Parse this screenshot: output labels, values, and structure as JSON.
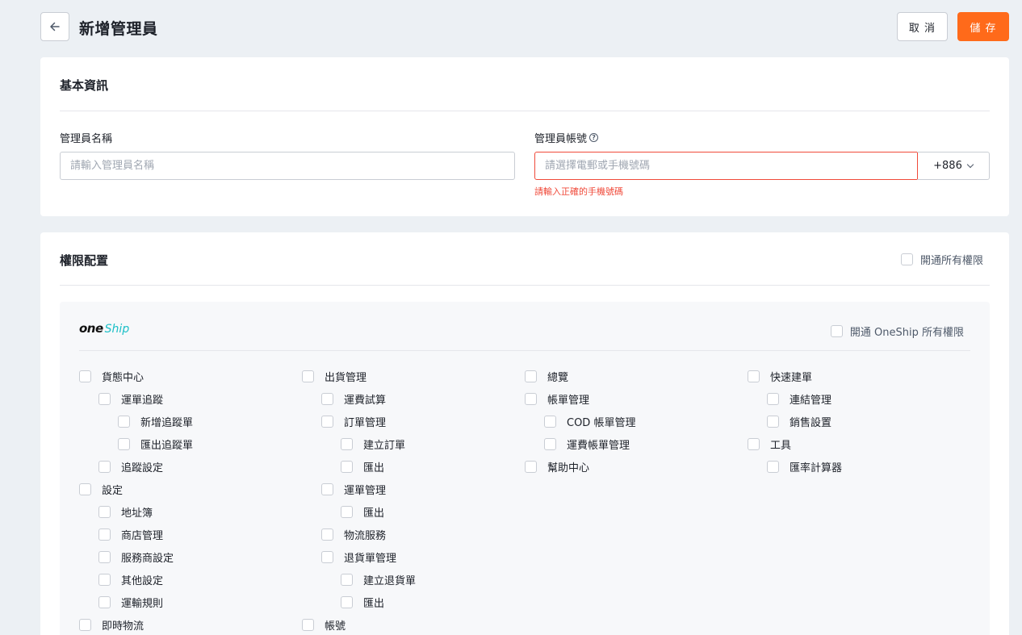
{
  "header": {
    "title": "新增管理員",
    "cancel_label": "取 消",
    "save_label": "儲 存"
  },
  "basic": {
    "section_title": "基本資訊",
    "name_label": "管理員名稱",
    "name_placeholder": "請輸入管理員名稱",
    "name_value": "",
    "account_label": "管理員帳號",
    "account_placeholder": "請選擇電郵或手機號碼",
    "account_value": "",
    "country_code": "+886",
    "error_message": "請輸入正確的手機號碼"
  },
  "permissions": {
    "section_title": "權限配置",
    "enable_all_label": "開通所有權限",
    "oneship": {
      "logo_one": "one",
      "logo_ship": "Ship",
      "enable_all_label": "開通 OneShip 所有權限",
      "columns": [
        [
          {
            "label": "貨態中心",
            "level": 0
          },
          {
            "label": "運單追蹤",
            "level": 1
          },
          {
            "label": "新增追蹤單",
            "level": 2
          },
          {
            "label": "匯出追蹤單",
            "level": 2
          },
          {
            "label": "追蹤設定",
            "level": 1
          },
          {
            "label": "設定",
            "level": 0
          },
          {
            "label": "地址簿",
            "level": 1
          },
          {
            "label": "商店管理",
            "level": 1
          },
          {
            "label": "服務商設定",
            "level": 1
          },
          {
            "label": "其他設定",
            "level": 1
          },
          {
            "label": "運輸規則",
            "level": 1
          },
          {
            "label": "即時物流",
            "level": 0
          }
        ],
        [
          {
            "label": "出貨管理",
            "level": 0
          },
          {
            "label": "運費試算",
            "level": 1
          },
          {
            "label": "訂單管理",
            "level": 1
          },
          {
            "label": "建立訂單",
            "level": 2
          },
          {
            "label": "匯出",
            "level": 2
          },
          {
            "label": "運單管理",
            "level": 1
          },
          {
            "label": "匯出",
            "level": 2
          },
          {
            "label": "物流服務",
            "level": 1
          },
          {
            "label": "退貨單管理",
            "level": 1
          },
          {
            "label": "建立退貨單",
            "level": 2
          },
          {
            "label": "匯出",
            "level": 2
          },
          {
            "label": "帳號",
            "level": 0
          }
        ],
        [
          {
            "label": "總覽",
            "level": 0
          },
          {
            "label": "帳單管理",
            "level": 0
          },
          {
            "label": "COD 帳單管理",
            "level": 1
          },
          {
            "label": "運費帳單管理",
            "level": 1
          },
          {
            "label": "幫助中心",
            "level": 0
          }
        ],
        [
          {
            "label": "快速建單",
            "level": 0
          },
          {
            "label": "連結管理",
            "level": 1
          },
          {
            "label": "銷售設置",
            "level": 1
          },
          {
            "label": "工具",
            "level": 0
          },
          {
            "label": "匯率計算器",
            "level": 1
          }
        ]
      ]
    }
  }
}
